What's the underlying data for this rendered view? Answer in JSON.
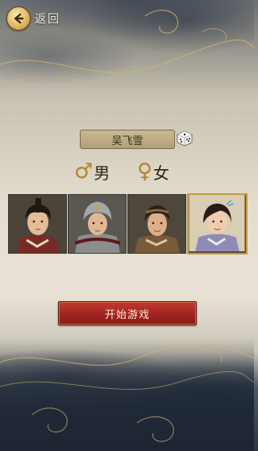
{
  "header": {
    "back_label": "返回"
  },
  "character": {
    "name": "吴飞雪"
  },
  "gender": {
    "male_symbol": "♂",
    "male_label": "男",
    "female_symbol": "♀",
    "female_label": "女",
    "selected": "female"
  },
  "portraits": {
    "count": 4,
    "selected_index": 3
  },
  "actions": {
    "start_label": "开始游戏"
  },
  "colors": {
    "accent_gold": "#c79a3a",
    "start_red": "#a0241f"
  }
}
